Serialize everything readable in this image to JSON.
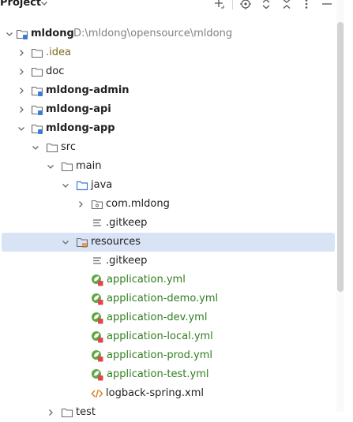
{
  "header": {
    "title": "Project"
  },
  "tree": {
    "root": {
      "name": "mldong",
      "path": "D:\\mldong\\opensource\\mldong"
    },
    "idea": ".idea",
    "doc": "doc",
    "admin": "mldong-admin",
    "api": "mldong-api",
    "app": "mldong-app",
    "src": "src",
    "main": "main",
    "java": "java",
    "package": "com.mldong",
    "gitkeep1": ".gitkeep",
    "resources": "resources",
    "gitkeep2": ".gitkeep",
    "app_yml": "application.yml",
    "demo_yml": "application-demo.yml",
    "dev_yml": "application-dev.yml",
    "local_yml": "application-local.yml",
    "prod_yml": "application-prod.yml",
    "test_yml": "application-test.yml",
    "logback": "logback-spring.xml",
    "test": "test"
  },
  "colors": {
    "selection": "#d9e3f6",
    "folder_excluded": "#7a6a1e",
    "yml_file": "#2f7d1f",
    "spring_leaf": "#5fa845",
    "xml_icon": "#e07a1b"
  }
}
